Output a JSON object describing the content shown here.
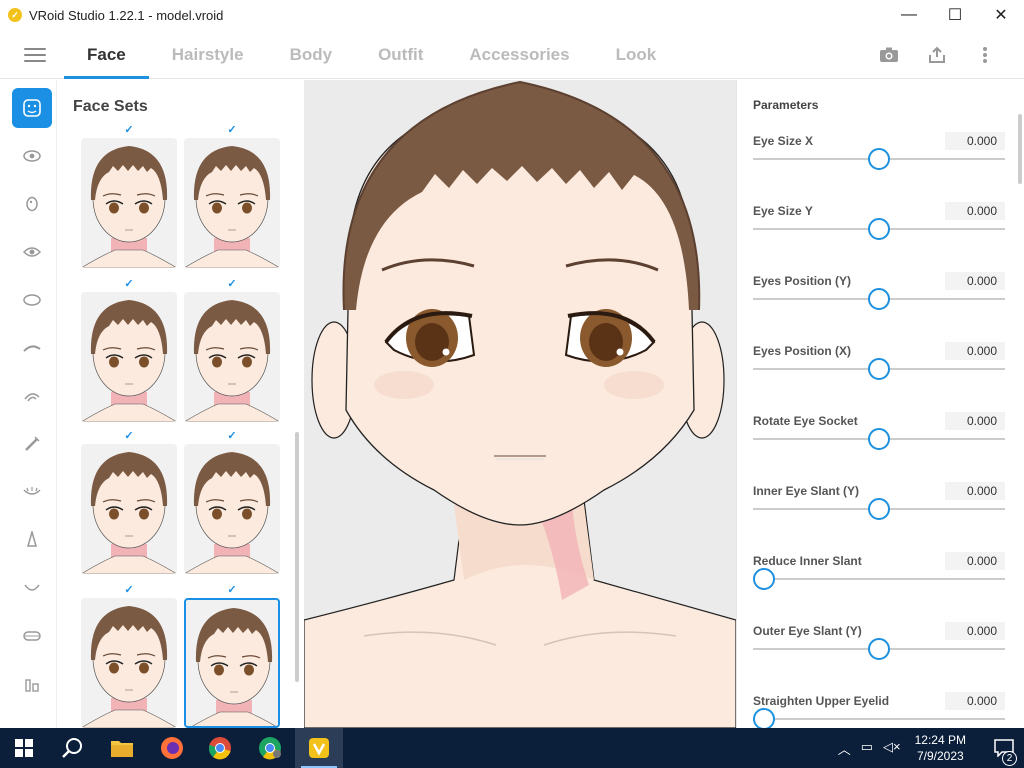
{
  "window": {
    "title": "VRoid Studio 1.22.1 - model.vroid",
    "minimize_label": "—",
    "maximize_label": "☐",
    "close_label": "✕"
  },
  "tabs": [
    {
      "label": "Face",
      "active": true
    },
    {
      "label": "Hairstyle",
      "active": false
    },
    {
      "label": "Body",
      "active": false
    },
    {
      "label": "Outfit",
      "active": false
    },
    {
      "label": "Accessories",
      "active": false
    },
    {
      "label": "Look",
      "active": false
    }
  ],
  "top_actions": [
    "camera-icon",
    "share-icon",
    "more-vert-icon"
  ],
  "rail_icons": [
    "face-set-icon",
    "eye-icon",
    "nose-icon",
    "eye-iris-icon",
    "face-shape-icon",
    "eyebrow-icon",
    "ear-icon",
    "eyelash-icon",
    "eyeline-icon",
    "nose-bridge-icon",
    "mouth-icon",
    "lip-icon",
    "teeth-icon"
  ],
  "face_sets": {
    "title": "Face Sets",
    "selected_index": 7,
    "count": 8
  },
  "parameters": {
    "header": "Parameters",
    "items": [
      {
        "label": "Eye Size X",
        "value": "0.000",
        "slider_fraction": 0.5
      },
      {
        "label": "Eye Size Y",
        "value": "0.000",
        "slider_fraction": 0.5
      },
      {
        "label": "Eyes Position (Y)",
        "value": "0.000",
        "slider_fraction": 0.5
      },
      {
        "label": "Eyes Position (X)",
        "value": "0.000",
        "slider_fraction": 0.5
      },
      {
        "label": "Rotate Eye Socket",
        "value": "0.000",
        "slider_fraction": 0.5
      },
      {
        "label": "Inner Eye Slant (Y)",
        "value": "0.000",
        "slider_fraction": 0.5
      },
      {
        "label": "Reduce Inner Slant",
        "value": "0.000",
        "slider_fraction": 0.0
      },
      {
        "label": "Outer Eye Slant (Y)",
        "value": "0.000",
        "slider_fraction": 0.5
      },
      {
        "label": "Straighten Upper Eyelid",
        "value": "0.000",
        "slider_fraction": 0.0
      }
    ]
  },
  "taskbar": {
    "apps": [
      "file-explorer-icon",
      "firefox-icon",
      "chrome-icon",
      "chrome-profile-icon",
      "vroid-studio-icon"
    ],
    "time": "12:24 PM",
    "date": "7/9/2023",
    "notification_count": "2"
  },
  "colors": {
    "accent": "#1a8fe3",
    "skin": "#fbeadd",
    "hair": "#7b5a44",
    "neck_shadow": "#f2b3b6",
    "taskbar": "#0b1e3a"
  }
}
